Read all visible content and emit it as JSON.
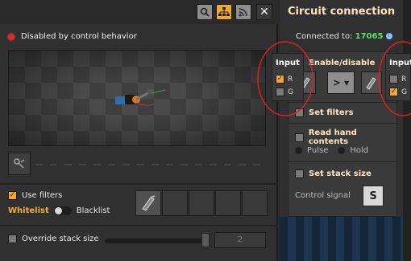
{
  "left_window": {
    "toolbar": {
      "buttons": [
        "search-icon",
        "logistics-network-icon",
        "wireless-icon",
        "close-icon"
      ],
      "close_glyph": "✕"
    },
    "status": {
      "text": "Disabled by control behavior",
      "color": "#e02a2a"
    },
    "filters": {
      "use_filters_label": "Use filters",
      "use_filters_checked": true,
      "whitelist_label": "Whitelist",
      "blacklist_label": "Blacklist",
      "filter_slots": [
        "inserter",
        "",
        "",
        "",
        ""
      ]
    },
    "override": {
      "label": "Override stack size",
      "checked": false,
      "value": "2"
    }
  },
  "circuit": {
    "title": "Circuit connection",
    "connected_label": "Connected to:",
    "connected_id": "17065",
    "info_glyph": "i",
    "enable_disable_label": "Enable/disable",
    "enable_disable_checked": true,
    "operator": ">",
    "set_filters_label": "Set filters",
    "read_hand_label": "Read hand contents",
    "pulse_label": "Pulse",
    "hold_label": "Hold",
    "set_stack_label": "Set stack size",
    "control_signal_label": "Control signal",
    "control_signal_value": "S"
  },
  "input_left": {
    "title": "Input",
    "r_label": "R",
    "g_label": "G",
    "r_checked": true,
    "g_checked": false
  },
  "input_right": {
    "title": "Input",
    "r_label": "R",
    "g_label": "G",
    "r_checked": false,
    "g_checked": true
  },
  "colors": {
    "accent": "#f0a834",
    "green": "#5ce06a",
    "annotation": "#e02020"
  }
}
